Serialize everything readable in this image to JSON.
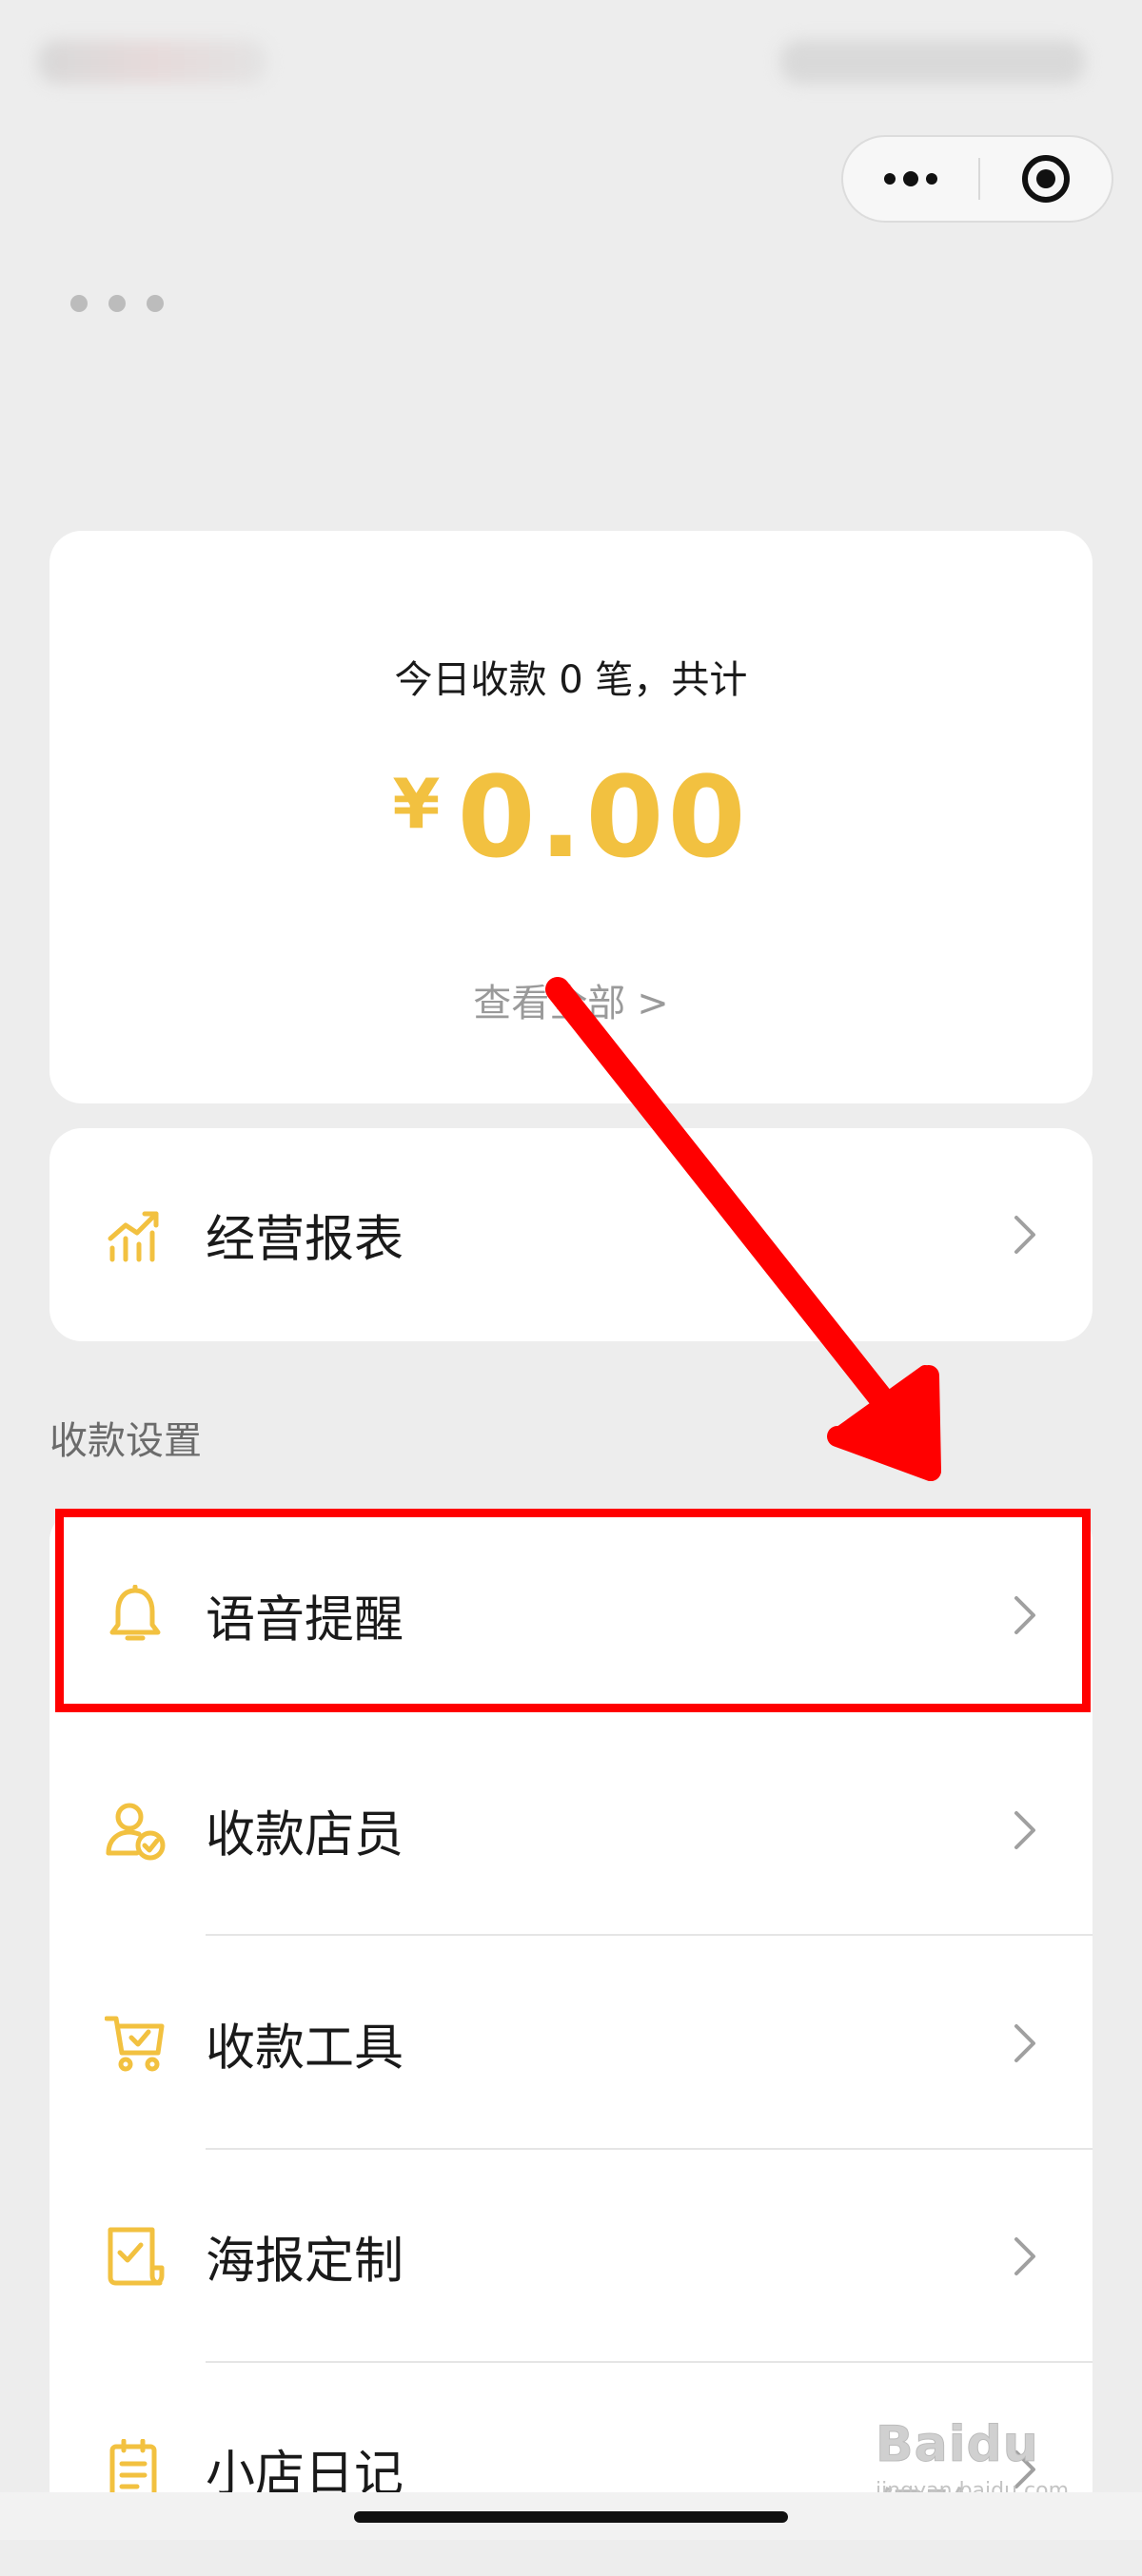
{
  "capsule": {
    "menu_icon": "ellipsis-icon",
    "close_icon": "target-icon"
  },
  "summary": {
    "line": "今日收款 0 笔，共计",
    "currency": "¥",
    "amount": "0.00",
    "view_all": "查看全部",
    "view_all_chevron": ">"
  },
  "report": {
    "label": "经营报表",
    "icon": "chart-trend-icon"
  },
  "section_title": "收款设置",
  "settings_items": [
    {
      "label": "语音提醒",
      "icon": "bell-icon"
    },
    {
      "label": "收款店员",
      "icon": "staff-check-icon"
    },
    {
      "label": "收款工具",
      "icon": "cart-check-icon"
    },
    {
      "label": "海报定制",
      "icon": "poster-check-icon"
    },
    {
      "label": "小店日记",
      "icon": "notebook-icon"
    }
  ],
  "watermark": {
    "main": "Baidu 经验",
    "sub": "jingyan.baidu.com"
  },
  "colors": {
    "accent_yellow": "#f2c140",
    "annotation_red": "#ff0000",
    "background": "#ededed",
    "card": "#ffffff"
  }
}
